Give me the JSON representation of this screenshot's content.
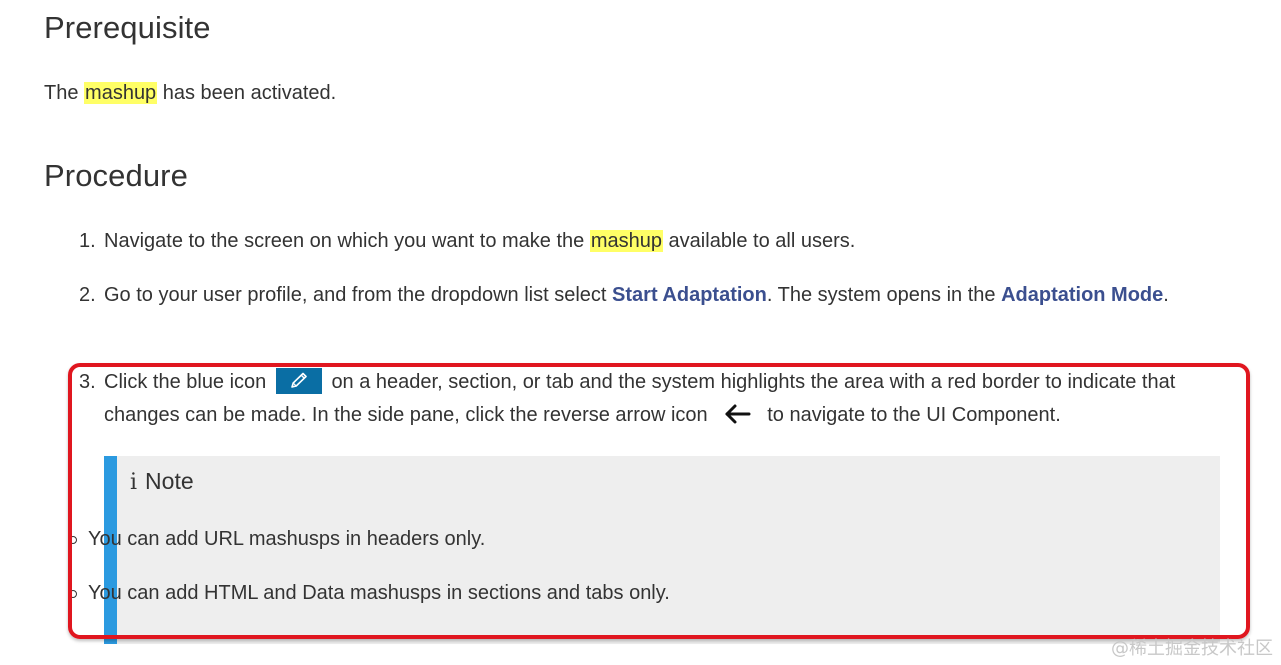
{
  "prerequisite": {
    "heading": "Prerequisite",
    "text_before": "The ",
    "highlight": "mashup",
    "text_after": " has been activated."
  },
  "procedure": {
    "heading": "Procedure",
    "steps": [
      {
        "num": "1.",
        "text_before": "Navigate to the screen on which you want to make the ",
        "highlight": "mashup",
        "text_after": " available to all users."
      },
      {
        "num": "2.",
        "text_before": "Go to your user profile, and from the dropdown list select ",
        "link1": "Start Adaptation",
        "text_middle": ". The system opens in the ",
        "link2": "Adaptation Mode",
        "text_after": "."
      },
      {
        "num": "3.",
        "text_before": "Click the blue icon",
        "text_middle": "on a header, section, or tab and the system highlights the area with a red border to indicate that changes can be made. In the side pane, click the reverse arrow icon",
        "text_after": "to navigate to the UI Component.",
        "edit_icon": "pencil-edit-icon",
        "edit_icon_color": "#0a6ea4",
        "arrow_icon": "left-arrow-icon"
      }
    ],
    "note": {
      "icon": "info-icon",
      "title": "Note",
      "bar_color": "#2b9ae0",
      "items": [
        "You can add URL mashusps in headers only.",
        "You can add HTML and Data mashusps in sections and tabs only."
      ]
    }
  },
  "annotation_border_color": "#e0161f",
  "highlight_color": "#ffff66",
  "link_color": "#3b4f8f",
  "watermark": "@稀土掘金技术社区"
}
